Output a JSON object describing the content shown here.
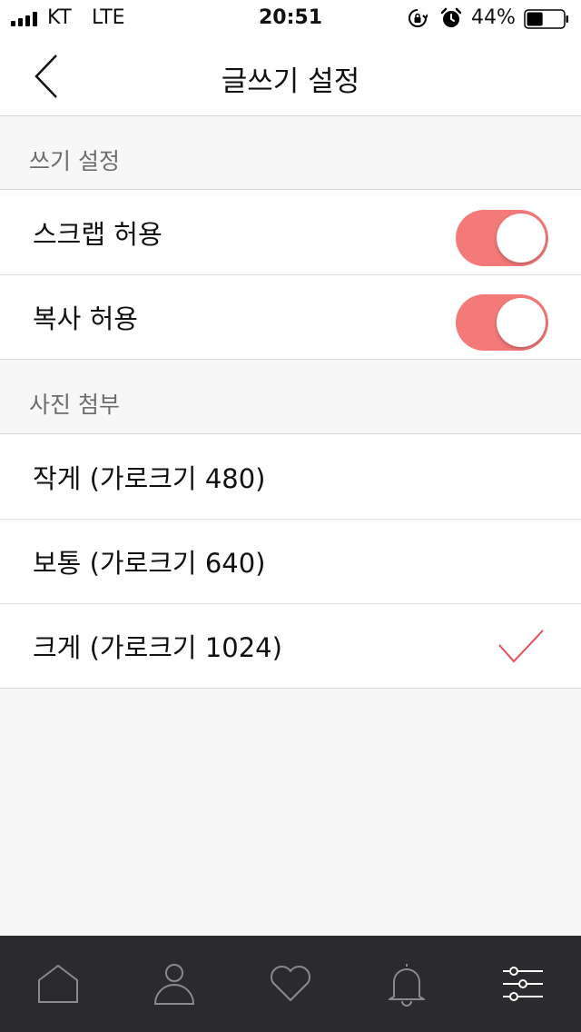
{
  "status_bar": {
    "carrier": "KT",
    "network": "LTE",
    "time": "20:51",
    "battery_percent": "44%",
    "battery_level": 0.44,
    "icons": [
      "signal-icon",
      "rotation-lock-icon",
      "alarm-icon",
      "battery-icon"
    ]
  },
  "nav": {
    "title": "글쓰기 설정",
    "back_icon": "chevron-left-icon"
  },
  "writing_settings": {
    "header": "쓰기 설정",
    "items": [
      {
        "label": "스크랩 허용",
        "enabled": true
      },
      {
        "label": "복사 허용",
        "enabled": true
      }
    ]
  },
  "photo_attach": {
    "header": "사진 첨부",
    "items": [
      {
        "label": "작게 (가로크기 480)",
        "selected": false
      },
      {
        "label": "보통 (가로크기 640)",
        "selected": false
      },
      {
        "label": "크게 (가로크기 1024)",
        "selected": true
      }
    ]
  },
  "tab_bar": {
    "tabs": [
      "home-icon",
      "person-icon",
      "heart-icon",
      "bell-icon",
      "settings-sliders-icon"
    ],
    "active": "settings-sliders-icon"
  },
  "colors": {
    "toggle_on": "#f47a7a",
    "check": "#e84a5a",
    "tab_bar_bg": "#2b2b2e",
    "tab_icon": "#8a8a8e",
    "tab_icon_active": "#ffffff"
  }
}
